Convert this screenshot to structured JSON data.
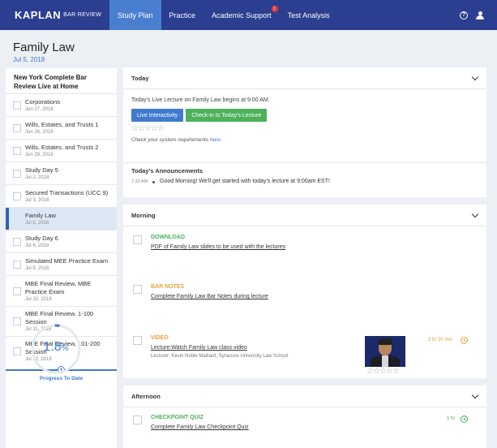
{
  "nav": {
    "brand": "KAPLAN",
    "brand_sub": "BAR REVIEW",
    "tabs": [
      {
        "label": "Study Plan"
      },
      {
        "label": "Practice"
      },
      {
        "label": "Academic Support",
        "badge": "1"
      },
      {
        "label": "Test Analysis"
      }
    ],
    "help_glyph": "?"
  },
  "page": {
    "title": "Family Law",
    "date": "Jul 5, 2018"
  },
  "sidebar": {
    "title": "New York Complete Bar Review Live at Home",
    "items": [
      {
        "name": "Corporations",
        "date": "Jun 27, 2018"
      },
      {
        "name": "Wills, Estates, and Trusts 1",
        "date": "Jun 28, 2018"
      },
      {
        "name": "Wills, Estates, and Trusts 2",
        "date": "Jun 29, 2018"
      },
      {
        "name": "Study Day 5",
        "date": "Jul 2, 2018"
      },
      {
        "name": "Secured Transactions (UCC 9)",
        "date": "Jul 3, 2018"
      },
      {
        "name": "Family Law",
        "date": "Jul 5, 2018"
      },
      {
        "name": "Study Day 6",
        "date": "Jul 6, 2018"
      },
      {
        "name": "Simulated MEE Practice Exam",
        "date": "Jul 9, 2018"
      },
      {
        "name": "MBE Final Review, MBE Practice Exam",
        "date": "Jul 10, 2018"
      },
      {
        "name": "MBE Final Review, 1-100 Session",
        "date": "Jul 11, 2018"
      },
      {
        "name": "MBE Final Review, 101-200 Session",
        "date": "Jul 12, 2018"
      }
    ],
    "progress_label": "Progress To Date",
    "progress_value": "1.8",
    "progress_unit": "%",
    "progress_fraction": 0.018
  },
  "today": {
    "header": "Today",
    "lecture_text": "Today's Live Lecture on Family Law begins at 9:00 AM.",
    "btn_interactivity": "Live Interactivity",
    "btn_checkin": "Check-in to Today's Lecture",
    "stars": "☆☆☆☆☆",
    "sysreq_prefix": "Check your system requirements",
    "sysreq_link": "here",
    "announcements_title": "Today's Announcements",
    "ann_time": "7:23 AM",
    "ann_text": "Good Morning! We'll get started with today's lecture at 9:00am EST!"
  },
  "morning": {
    "header": "Morning",
    "tasks": [
      {
        "type": "DOWNLOAD",
        "desc": "PDF of Family Law slides to be used with the lectures"
      },
      {
        "type": "BAR NOTES",
        "desc": "Complete Family Law Bar Notes during lecture"
      },
      {
        "type": "VIDEO",
        "desc": "Lecture:Watch Family Law class video",
        "lecturer": "Lecturer: Kevin Noble Maillard, Syracuse University Law School",
        "duration": "3 hr 30 min",
        "stars": "☆☆☆☆☆"
      }
    ]
  },
  "afternoon": {
    "header": "Afternoon",
    "tasks": [
      {
        "type": "CHECKPOINT QUIZ",
        "desc": "Complete Family Law Checkpoint Quiz",
        "duration": "1 hr"
      }
    ]
  },
  "colors": {
    "nav_bg": "#2b3e8f",
    "accent": "#3f7ad0",
    "green": "#4cb15a",
    "orange": "#e6a23c"
  }
}
